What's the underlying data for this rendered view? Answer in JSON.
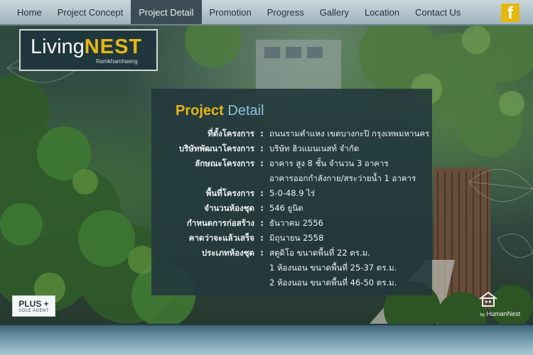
{
  "nav": {
    "items": [
      {
        "label": "Home"
      },
      {
        "label": "Project Concept"
      },
      {
        "label": "Project Detail"
      },
      {
        "label": "Promotion"
      },
      {
        "label": "Progress"
      },
      {
        "label": "Gallery"
      },
      {
        "label": "Location"
      },
      {
        "label": "Contact Us"
      }
    ],
    "active_index": 2,
    "facebook_icon": "facebook-icon",
    "facebook_letter": "f"
  },
  "logo": {
    "main_a": "Living",
    "main_b": "NEST",
    "sub": "Ramkhamhaeng"
  },
  "panel": {
    "title_a": "Project",
    "title_b": "Detail",
    "separator": ":",
    "rows": [
      {
        "key": "ที่ตั้งโครงการ",
        "values": [
          "ถนนรามคำแหง เขตบางกะปิ กรุงเทพมหานคร"
        ]
      },
      {
        "key": "บริษัทพัฒนาโครงการ",
        "values": [
          "บริษัท ฮิวแมนเนสท์ จำกัด"
        ]
      },
      {
        "key": "ลักษณะโครงการ",
        "values": [
          "อาคาร สูง 8 ชั้น จำนวน 3 อาคาร",
          "อาคารออกกำลังกาย/สระว่ายน้ำ 1 อาคาร"
        ]
      },
      {
        "key": "พื้นที่โครงการ",
        "values": [
          "5-0-48.9 ไร่"
        ]
      },
      {
        "key": "จำนวนห้องชุด",
        "values": [
          "546 ยูนิต"
        ]
      },
      {
        "key": "กำหนดการก่อสร้าง",
        "values": [
          "ธันวาคม 2556"
        ]
      },
      {
        "key": "คาดว่าจะแล้วเสร็จ",
        "values": [
          "มิถุนายน 2558"
        ]
      },
      {
        "key": "ประเภทห้องชุด",
        "values": [
          "สตูดิโอ ขนาดพื้นที่ 22 ตร.ม.",
          "1 ห้องนอน ขนาดพื้นที่ 25-37 ตร.ม.",
          "2 ห้องนอน ขนาดพื้นที่ 46-50 ตร.ม."
        ]
      }
    ]
  },
  "badges": {
    "plus_main": "PLUS +",
    "plus_sub": "SOLE AGENT",
    "humannest_by": "by",
    "humannest_label": "HumanNest"
  },
  "colors": {
    "accent_yellow": "#e7b815",
    "accent_blue": "#8fc6dc",
    "nav_active": "#3c4c55"
  }
}
